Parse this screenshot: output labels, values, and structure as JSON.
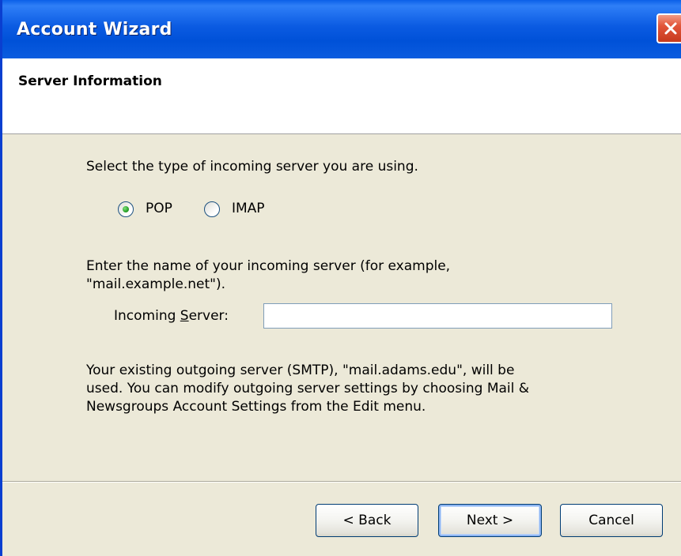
{
  "window": {
    "title": "Account Wizard"
  },
  "header": {
    "title": "Server Information"
  },
  "server_type": {
    "prompt": "Select the type of incoming server you are using.",
    "options": [
      {
        "label": "POP",
        "selected": true
      },
      {
        "label": "IMAP",
        "selected": false
      }
    ]
  },
  "incoming": {
    "prompt_line1": "Enter the name of your incoming server (for example,",
    "prompt_line2": "\"mail.example.net\").",
    "label_prefix": "Incoming ",
    "label_accel": "S",
    "label_suffix": "erver:",
    "value": ""
  },
  "outgoing_note": {
    "line1": "Your existing outgoing server (SMTP), \"mail.adams.edu\", will be",
    "line2": "used. You can modify outgoing server settings by choosing Mail &",
    "line3": "Newsgroups Account Settings from the Edit menu."
  },
  "buttons": {
    "back": "< Back",
    "next": "Next >",
    "cancel": "Cancel"
  },
  "colors": {
    "titlebar": "#0054e3",
    "dialog_bg": "#ece9d8",
    "close_button": "#e2553a",
    "radio_selected": "#2aa22a"
  },
  "icons": {
    "close": "close-icon"
  }
}
